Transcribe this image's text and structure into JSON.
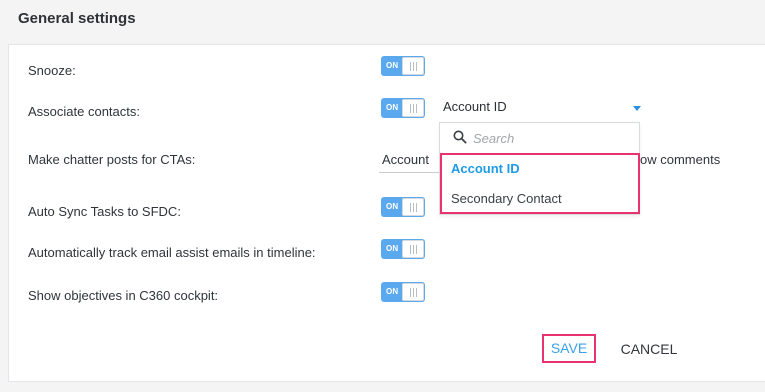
{
  "header": {
    "title": "General settings"
  },
  "rows": [
    {
      "label": "Snooze:",
      "toggle": "ON"
    },
    {
      "label": "Associate contacts:",
      "toggle": "ON"
    },
    {
      "label": "Make chatter posts for CTAs:"
    },
    {
      "label": "Auto Sync Tasks to SFDC:",
      "toggle": "ON"
    },
    {
      "label": "Automatically track email assist emails in timeline:",
      "toggle": "ON"
    },
    {
      "label": "Show objectives in C360 cockpit:",
      "toggle": "ON"
    }
  ],
  "associate_select": {
    "selected": "Account ID",
    "search_placeholder": "Search",
    "options": [
      "Account ID",
      "Secondary Contact"
    ]
  },
  "chatter": {
    "left_text": "Account",
    "right_text": "ow comments"
  },
  "actions": {
    "save_label": "SAVE",
    "cancel_label": "CANCEL"
  },
  "colors": {
    "toggle_on": "#5aa9ef",
    "accent_blue": "#1e9be8",
    "highlight_pink": "#e8336f"
  },
  "icons": {
    "search": "search-icon",
    "caret": "chevron-down-icon"
  }
}
